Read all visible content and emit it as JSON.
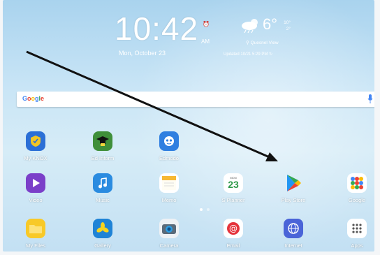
{
  "clock": {
    "time": "10:42",
    "ampm": "AM",
    "alarm": "⏰",
    "date": "Mon, October 23"
  },
  "weather": {
    "icon": "cloud-rain-icon",
    "temperature": "6°",
    "high": "10°",
    "low": "2°",
    "location": "Quesnel View",
    "updated": "Updated 10/21 5:29 PM"
  },
  "search": {
    "brand": "Google",
    "mic_icon": "mic-icon"
  },
  "apps": [
    {
      "label": "My KNOX",
      "icon": "knox-shield-icon",
      "color": "#2b6fd6"
    },
    {
      "label": "Ed Inform",
      "icon": "graduation-cap-icon",
      "color": "#3f8f3a"
    },
    {
      "label": "Edmodo",
      "icon": "edmodo-face-icon",
      "color": "#2f7fe0"
    },
    {
      "label": "Video",
      "icon": "play-icon",
      "color": "#7b3fc9"
    },
    {
      "label": "Music",
      "icon": "music-note-icon",
      "color": "#2a8be0"
    },
    {
      "label": "Memo",
      "icon": "memo-icon",
      "color": "#f6b833"
    },
    {
      "label": "S Planner",
      "icon": "calendar-icon",
      "color": "#ffffff",
      "day": "23",
      "month": "MON"
    },
    {
      "label": "Play Store",
      "icon": "play-store-icon",
      "color": "transparent"
    },
    {
      "label": "Google",
      "icon": "google-folder-icon",
      "color": "#ffffff"
    },
    {
      "label": "My Files",
      "icon": "folder-icon",
      "color": "#f8c928"
    },
    {
      "label": "Gallery",
      "icon": "gallery-flower-icon",
      "color": "#1f83d6"
    },
    {
      "label": "Camera",
      "icon": "camera-icon",
      "color": "#eef1f4"
    },
    {
      "label": "Email",
      "icon": "email-at-icon",
      "color": "#e5343c"
    },
    {
      "label": "Internet",
      "icon": "globe-icon",
      "color": "#4a64d8"
    },
    {
      "label": "Apps",
      "icon": "apps-grid-icon",
      "color": "#ffffff"
    }
  ],
  "page_indicator": {
    "pages": 2,
    "current": 1
  }
}
